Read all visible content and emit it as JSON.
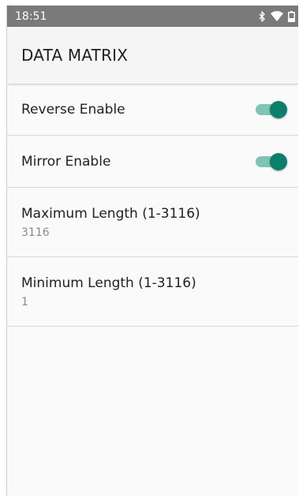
{
  "status_bar": {
    "time": "18:51",
    "icons": [
      "bluetooth-icon",
      "wifi-icon",
      "battery-icon"
    ]
  },
  "app_bar": {
    "title": "DATA MATRIX"
  },
  "settings": {
    "reverse_enable": {
      "label": "Reverse Enable",
      "checked": true
    },
    "mirror_enable": {
      "label": "Mirror Enable",
      "checked": true
    },
    "maximum_length": {
      "label": "Maximum Length (1-3116)",
      "value": "3116"
    },
    "minimum_length": {
      "label": "Minimum Length (1-3116)",
      "value": "1"
    }
  },
  "colors": {
    "accent": "#0b7f6b",
    "accent_track": "#80c4b6",
    "status_bar": "#7a7a7a"
  }
}
